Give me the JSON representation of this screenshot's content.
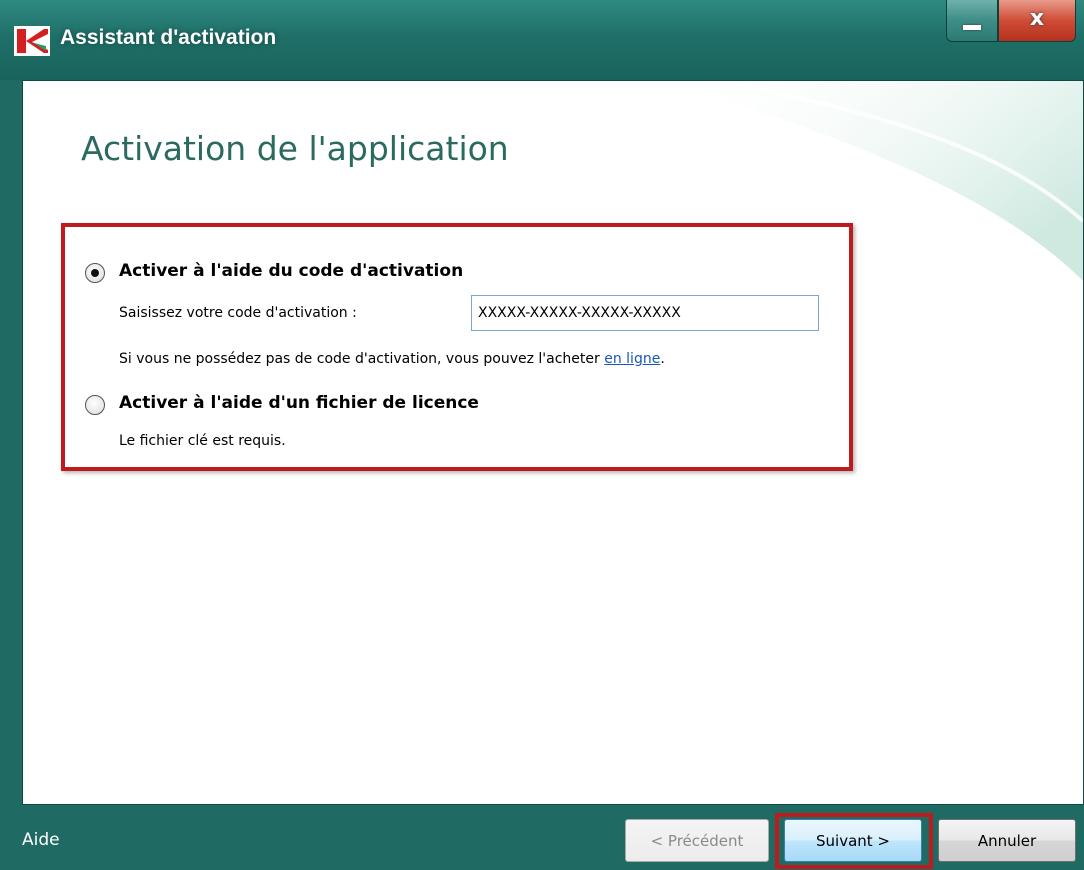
{
  "window": {
    "title": "Assistant d'activation",
    "minimize_symbol": "",
    "close_symbol": "x"
  },
  "page": {
    "title": "Activation de l'application"
  },
  "option_code": {
    "label": "Activer à l'aide du code d'activation",
    "selected": true,
    "input_label": "Saisissez votre code d'activation :",
    "input_value": "XXXXX-XXXXX-XXXXX-XXXXX",
    "info_text": "Si vous ne possédez pas de code d'activation, vous pouvez l'acheter ",
    "link_text": "en ligne",
    "info_end": "."
  },
  "option_file": {
    "label": "Activer à l'aide d'un fichier de licence",
    "selected": false,
    "description": "Le fichier clé est requis."
  },
  "footer": {
    "help_label": "Aide",
    "prev_label": "< Précédent",
    "next_label": "Suivant >",
    "cancel_label": "Annuler"
  },
  "colors": {
    "frame": "#1f6a63",
    "title_accent": "#2b6a5f",
    "highlight": "#bd1b1e",
    "link": "#1a57b8"
  },
  "icons": {
    "app_logo": "kaspersky-k-logo",
    "minimize": "minimize-icon",
    "close": "close-icon"
  }
}
